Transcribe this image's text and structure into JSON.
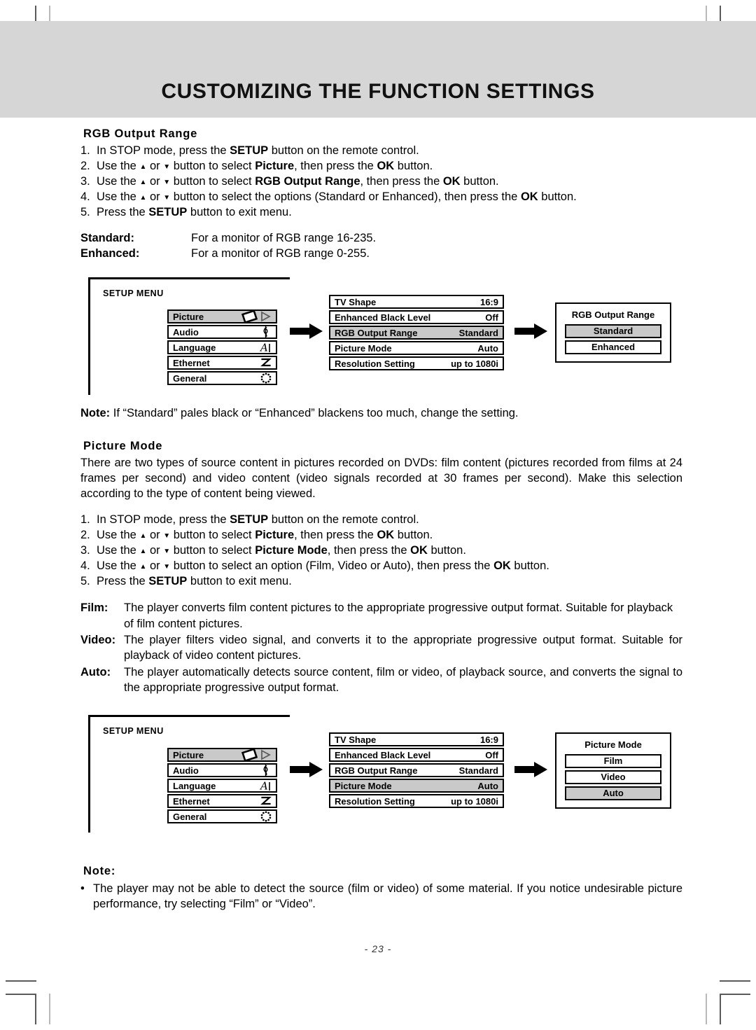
{
  "page": {
    "title": "CUSTOMIZING THE FUNCTION SETTINGS",
    "page_number": "- 23 -"
  },
  "section_rgb": {
    "heading": "RGB Output Range",
    "steps": [
      {
        "num": "1.",
        "parts": [
          {
            "t": "In STOP mode, press the ",
            "b": false
          },
          {
            "t": "SETUP",
            "b": true
          },
          {
            "t": " button on the remote control.",
            "b": false
          }
        ]
      },
      {
        "num": "2.",
        "parts": [
          {
            "t": "Use the ",
            "b": false
          },
          {
            "icon": "triangle-up"
          },
          {
            "t": " or ",
            "b": false
          },
          {
            "icon": "triangle-down"
          },
          {
            "t": " button to select ",
            "b": false
          },
          {
            "t": "Picture",
            "b": true
          },
          {
            "t": ", then press the ",
            "b": false
          },
          {
            "t": "OK",
            "b": true
          },
          {
            "t": " button.",
            "b": false
          }
        ]
      },
      {
        "num": "3.",
        "parts": [
          {
            "t": "Use the ",
            "b": false
          },
          {
            "icon": "triangle-up"
          },
          {
            "t": " or ",
            "b": false
          },
          {
            "icon": "triangle-down"
          },
          {
            "t": " button to select ",
            "b": false
          },
          {
            "t": "RGB Output Range",
            "b": true
          },
          {
            "t": ", then press the ",
            "b": false
          },
          {
            "t": "OK",
            "b": true
          },
          {
            "t": " button.",
            "b": false
          }
        ]
      },
      {
        "num": "4.",
        "parts": [
          {
            "t": "Use the ",
            "b": false
          },
          {
            "icon": "triangle-up"
          },
          {
            "t": " or ",
            "b": false
          },
          {
            "icon": "triangle-down"
          },
          {
            "t": " button to select the options (Standard or Enhanced), then press the ",
            "b": false
          },
          {
            "t": "OK",
            "b": true
          },
          {
            "t": " button.",
            "b": false
          }
        ]
      },
      {
        "num": "5.",
        "parts": [
          {
            "t": "Press the ",
            "b": false
          },
          {
            "t": "SETUP",
            "b": true
          },
          {
            "t": " button to exit menu.",
            "b": false
          }
        ]
      }
    ],
    "definitions": [
      {
        "term": "Standard:",
        "desc": "For a monitor of RGB range 16-235."
      },
      {
        "term": "Enhanced:",
        "desc": "For a monitor of RGB range 0-255."
      }
    ],
    "note_label": "Note:",
    "note_text": " If “Standard” pales black or “Enhanced” blackens too much, change the setting."
  },
  "section_picture_mode": {
    "heading": "Picture Mode",
    "intro": "There are two types of source content in pictures recorded on DVDs: film content (pictures recorded from films at 24 frames per second) and video content (video signals recorded at 30 frames per second). Make this selection according to the type of content being viewed.",
    "steps": [
      {
        "num": "1.",
        "parts": [
          {
            "t": "In STOP mode, press the ",
            "b": false
          },
          {
            "t": "SETUP",
            "b": true
          },
          {
            "t": " button on the remote control.",
            "b": false
          }
        ]
      },
      {
        "num": "2.",
        "parts": [
          {
            "t": "Use the ",
            "b": false
          },
          {
            "icon": "triangle-up"
          },
          {
            "t": " or ",
            "b": false
          },
          {
            "icon": "triangle-down"
          },
          {
            "t": " button to select ",
            "b": false
          },
          {
            "t": "Picture",
            "b": true
          },
          {
            "t": ", then press the ",
            "b": false
          },
          {
            "t": "OK",
            "b": true
          },
          {
            "t": " button.",
            "b": false
          }
        ]
      },
      {
        "num": "3.",
        "parts": [
          {
            "t": "Use the ",
            "b": false
          },
          {
            "icon": "triangle-up"
          },
          {
            "t": " or ",
            "b": false
          },
          {
            "icon": "triangle-down"
          },
          {
            "t": " button to select ",
            "b": false
          },
          {
            "t": "Picture Mode",
            "b": true
          },
          {
            "t": ", then press the ",
            "b": false
          },
          {
            "t": "OK",
            "b": true
          },
          {
            "t": " button.",
            "b": false
          }
        ]
      },
      {
        "num": "4.",
        "parts": [
          {
            "t": "Use the ",
            "b": false
          },
          {
            "icon": "triangle-up"
          },
          {
            "t": " or ",
            "b": false
          },
          {
            "icon": "triangle-down"
          },
          {
            "t": " button to select an option (Film, Video or Auto), then press the ",
            "b": false
          },
          {
            "t": "OK",
            "b": true
          },
          {
            "t": " button.",
            "b": false
          }
        ]
      },
      {
        "num": "5.",
        "parts": [
          {
            "t": "Press the ",
            "b": false
          },
          {
            "t": "SETUP",
            "b": true
          },
          {
            "t": " button to exit menu.",
            "b": false
          }
        ]
      }
    ],
    "definitions": [
      {
        "term": "Film:",
        "desc": "The player converts film content pictures to the appropriate progressive output format. Suitable for playback of film content pictures."
      },
      {
        "term": "Video:",
        "desc": "The player filters video signal, and converts it to the appropriate progressive output format. Suitable for playback of video content pictures."
      },
      {
        "term": "Auto:",
        "desc": "The player automatically detects source content, film or video, of playback source, and converts the signal to the appropriate progressive output format."
      }
    ]
  },
  "bottom_note": {
    "label": "Note:",
    "bullet": "•",
    "text": "The player may not be able to detect the source (film or video) of some material. If you notice undesirable picture performance, try selecting “Film” or “Video”."
  },
  "diagram_rgb": {
    "setup_menu_label": "SETUP MENU",
    "setup_items": [
      {
        "label": "Picture",
        "icon": "picture-diamond-icon",
        "selected": true
      },
      {
        "label": "Audio",
        "icon": "music-note-icon",
        "selected": false
      },
      {
        "label": "Language",
        "icon": "letter-a-icon",
        "selected": false
      },
      {
        "label": "Ethernet",
        "icon": "network-icon",
        "selected": false
      },
      {
        "label": "General",
        "icon": "dotted-circle-icon",
        "selected": false
      }
    ],
    "picture_settings": [
      {
        "label": "TV Shape",
        "value": "16:9",
        "selected": false
      },
      {
        "label": "Enhanced Black Level",
        "value": "Off",
        "selected": false
      },
      {
        "label": "RGB Output Range",
        "value": "Standard",
        "selected": true
      },
      {
        "label": "Picture Mode",
        "value": "Auto",
        "selected": false
      },
      {
        "label": "Resolution Setting",
        "value": "up to 1080i",
        "selected": false
      }
    ],
    "option_panel": {
      "title": "RGB Output Range",
      "options": [
        {
          "label": "Standard",
          "selected": true
        },
        {
          "label": "Enhanced",
          "selected": false
        }
      ]
    }
  },
  "diagram_picture_mode": {
    "setup_menu_label": "SETUP MENU",
    "setup_items": [
      {
        "label": "Picture",
        "icon": "picture-diamond-icon",
        "selected": true
      },
      {
        "label": "Audio",
        "icon": "music-note-icon",
        "selected": false
      },
      {
        "label": "Language",
        "icon": "letter-a-icon",
        "selected": false
      },
      {
        "label": "Ethernet",
        "icon": "network-icon",
        "selected": false
      },
      {
        "label": "General",
        "icon": "dotted-circle-icon",
        "selected": false
      }
    ],
    "picture_settings": [
      {
        "label": "TV Shape",
        "value": "16:9",
        "selected": false
      },
      {
        "label": "Enhanced Black Level",
        "value": "Off",
        "selected": false
      },
      {
        "label": "RGB Output Range",
        "value": "Standard",
        "selected": false
      },
      {
        "label": "Picture Mode",
        "value": "Auto",
        "selected": true
      },
      {
        "label": "Resolution Setting",
        "value": "up to 1080i",
        "selected": false
      }
    ],
    "option_panel": {
      "title": "Picture Mode",
      "options": [
        {
          "label": "Film",
          "selected": false
        },
        {
          "label": "Video",
          "selected": false
        },
        {
          "label": "Auto",
          "selected": true
        }
      ]
    }
  },
  "colors": {
    "banner": "#d6d6d6",
    "highlight": "#c9c9c9",
    "ink": "#000000"
  }
}
